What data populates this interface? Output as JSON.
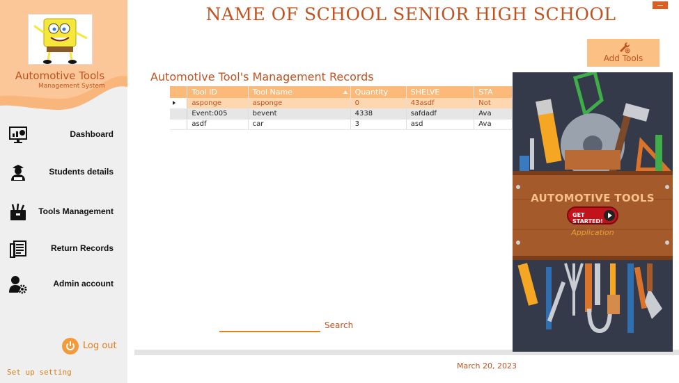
{
  "app": {
    "name": "Automotive Tools",
    "subtitle": "Management System",
    "school_title": "NAME OF SCHOOL SENIOR HIGH SCHOOL"
  },
  "sidebar": {
    "items": [
      {
        "label": "Dashboard",
        "icon": "dashboard-monitor-icon"
      },
      {
        "label": "Students details",
        "icon": "student-icon"
      },
      {
        "label": "Tools Management",
        "icon": "toolbox-icon"
      },
      {
        "label": "Return Records",
        "icon": "records-icon"
      },
      {
        "label": "Admin account",
        "icon": "admin-gear-icon"
      }
    ],
    "logout_label": "Log out",
    "setup_label": "Set up setting"
  },
  "header": {
    "add_tools_label": "Add Tools",
    "add_tools_icon": "wrench-add-icon"
  },
  "records": {
    "title": "Automotive Tool's Management Records",
    "columns": [
      "Tool ID",
      "Tool Name",
      "Quantity",
      "SHELVE",
      "STA"
    ],
    "rows": [
      [
        "asponge",
        "asponge",
        "0",
        "43asdf",
        "Not"
      ],
      [
        "Event:005",
        "bevent",
        "4338",
        "safdadf",
        "Ava"
      ],
      [
        "asdf",
        "car",
        "3",
        "asd",
        "Ava"
      ]
    ],
    "selected_row": 0
  },
  "search": {
    "label": "Search",
    "value": ""
  },
  "footer": {
    "date": "March 20, 2023"
  },
  "poster": {
    "title": "AUTOMOTIVE TOOLS",
    "button_label": "GET STARTED!",
    "subtitle": "Application"
  },
  "colors": {
    "accent": "#c0521f",
    "header_orange": "#fbb97a",
    "selected_row": "#fcd7b0"
  }
}
